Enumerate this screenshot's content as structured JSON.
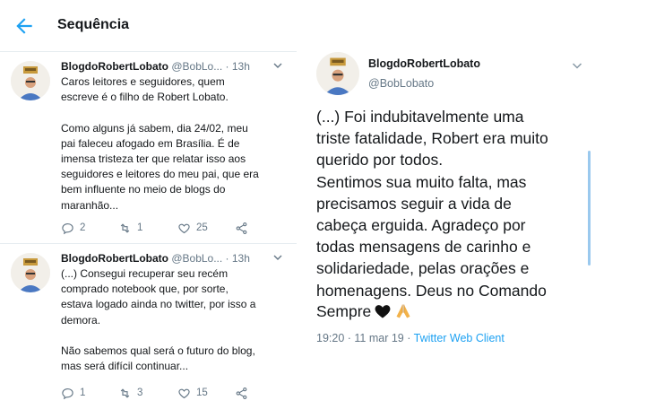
{
  "header": {
    "title": "Sequência",
    "back_icon": "back-arrow-icon",
    "accent_color": "#1da1f2"
  },
  "thread": [
    {
      "name": "BlogdoRobertLobato",
      "handle_time": "@BobLo... · 13h",
      "text": "Caros leitores e seguidores, quem\nescreve é o filho de Robert Lobato.\n\nComo alguns já sabem, dia 24/02, meu\npai faleceu afogado em Brasília. É de\nimensa tristeza ter que relatar isso aos\nseguidores e leitores do meu pai, que era\nbem influente no meio de blogs do\nmaranhão...",
      "replies": "2",
      "retweets": "1",
      "likes": "25"
    },
    {
      "name": "BlogdoRobertLobato",
      "handle_time": "@BobLo... · 13h",
      "text": "(...) Consegui recuperar seu recém\ncomprado notebook que, por sorte,\nestava logado ainda no twitter, por isso a\ndemora.\n\nNão sabemos qual será o futuro do blog,\nmas será difícil continuar...",
      "replies": "1",
      "retweets": "3",
      "likes": "15"
    }
  ],
  "detail": {
    "name": "BlogdoRobertLobato",
    "handle": "@BobLobato",
    "text": "(...) Foi indubitavelmente uma\ntriste fatalidade, Robert era muito\nquerido por todos.\nSentimos sua muito falta, mas\nprecisamos seguir a vida de\ncabeça erguida. Agradeço por\ntodas mensagens de carinho e\nsolidariedade, pelas orações e\nhomenagens. Deus no Comando",
    "last_word": "Sempre",
    "emojis": [
      "black-heart-icon",
      "folded-hands-icon"
    ],
    "timestamp": "19:20 · 11 mar 19 · ",
    "client": "Twitter Web Client"
  }
}
